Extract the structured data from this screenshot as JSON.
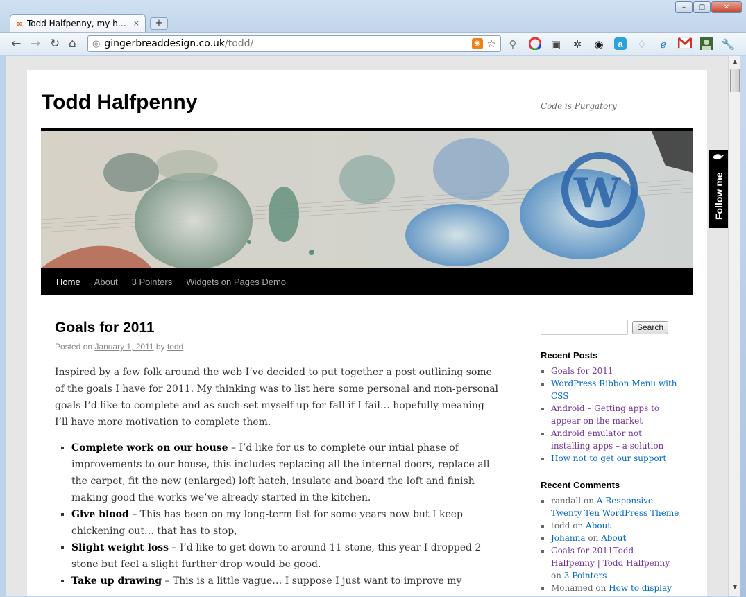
{
  "browser": {
    "tab_title": "Todd Halfpenny, my ho...",
    "tab_close": "×",
    "new_tab": "+",
    "url_host": "gingerbreaddesign.co.uk",
    "url_path": "/todd/",
    "window_buttons": {
      "minimize": "–",
      "maximize": "□",
      "close": "✕"
    },
    "nav_icons": {
      "back": "←",
      "forward": "→",
      "reload": "↻",
      "home": "⌂"
    },
    "extension_icons": [
      "magnifier-icon",
      "color-wheel-icon",
      "screenshot-icon",
      "gear-icon",
      "record-icon",
      "a-icon",
      "tooth-icon",
      "ie-icon",
      "gmail-icon",
      "avatar-icon",
      "wrench-icon"
    ]
  },
  "site": {
    "title": "Todd Halfpenny",
    "tagline": "Code is Purgatory"
  },
  "nav": {
    "items": [
      "Home",
      "About",
      "3 Pointers",
      "Widgets on Pages Demo"
    ]
  },
  "post": {
    "title": "Goals for 2011",
    "posted_on": "Posted on",
    "date": "January 1, 2011",
    "by": "by",
    "author": "todd",
    "intro": "Inspired by a few folk around the web I’ve decided to put together a post outlining some of the goals I have for 2011. My thinking was to list here some personal and non-personal goals I’d like to complete and as such set myself up for fall if I fail… hopefully meaning I’ll have more motivation to complete them.",
    "goals": [
      {
        "title": "Complete work on our house",
        "text": " – I’d like for us to complete our intial phase of improvements to our house, this includes replacing all the internal doors, replace all the carpet, fit the new (enlarged) loft hatch, insulate and board the loft and finish making good the works we’ve already started in the kitchen."
      },
      {
        "title": "Give blood",
        "text": " – This has been on my long-term list for some years now but I keep chickening out… that has to stop,"
      },
      {
        "title": "Slight weight loss",
        "text": " – I’d like to get down to around 11 stone, this year I dropped 2 stone but feel a slight further drop would be good."
      },
      {
        "title": "Take up drawing",
        "text": " – This is a little vague… I suppose I just want to improve my"
      }
    ]
  },
  "sidebar": {
    "search_button": "Search",
    "recent_posts_title": "Recent Posts",
    "recent_posts": [
      "Goals for 2011",
      "WordPress Ribbon Menu with CSS",
      "Android – Getting apps to appear on the market",
      "Android emulator not installing apps – a solution",
      "How not to get our support"
    ],
    "recent_comments_title": "Recent Comments",
    "recent_comments": [
      {
        "author": "randall",
        "on": "on",
        "post": "A Responsive Twenty Ten WordPress Theme"
      },
      {
        "author": "todd",
        "on": "on",
        "post": "About"
      },
      {
        "author": "Johanna",
        "on": "on",
        "post": "About"
      },
      {
        "author": "Goals for 2011Todd Halfpenny | Todd Halfpenny",
        "on": "on",
        "post": "3 Pointers"
      },
      {
        "author": "Mohamed",
        "on": "on",
        "post": "How to display Widgets inside posts and pages"
      }
    ]
  },
  "follow_tab": "Follow me",
  "colors": {
    "link": "#0066cc",
    "visited": "#743399",
    "nav_bg": "#000000",
    "page_bg": "#e6e6e6"
  }
}
